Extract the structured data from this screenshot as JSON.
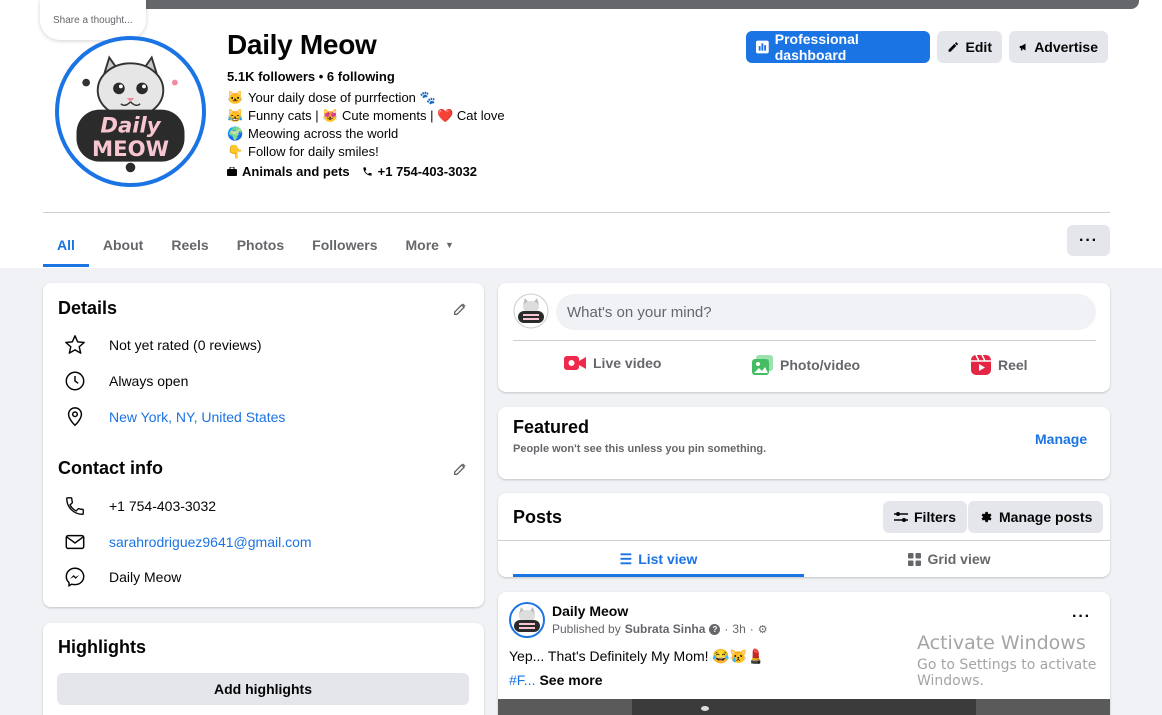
{
  "thought_bubble": "Share a thought...",
  "profile": {
    "name": "Daily Meow",
    "followers_line": "5.1K followers • 6 following",
    "bio": [
      {
        "emoji": "🐱",
        "text": "Your daily dose of purrfection 🐾"
      },
      {
        "emoji": "😹",
        "text": "Funny cats | 😻 Cute moments | ❤️ Cat love"
      },
      {
        "emoji": "🌍",
        "text": "Meowing across the world"
      },
      {
        "emoji": "👇",
        "text": "Follow for daily smiles!"
      }
    ],
    "category": "Animals and pets",
    "phone": "+1 754-403-3032",
    "logo_text_top": "Daily",
    "logo_text_bottom": "MEOW"
  },
  "actions": {
    "dashboard": "Professional dashboard",
    "edit": "Edit",
    "advertise": "Advertise"
  },
  "tabs": [
    "All",
    "About",
    "Reels",
    "Photos",
    "Followers",
    "More"
  ],
  "details": {
    "title": "Details",
    "items": [
      "Not yet rated (0 reviews)",
      "Always open",
      "New York, NY, United States"
    ]
  },
  "contact": {
    "title": "Contact info",
    "phone": "+1 754-403-3032",
    "email": "sarahrodriguez9641@gmail.com",
    "messenger": "Daily Meow"
  },
  "highlights": {
    "title": "Highlights",
    "button": "Add highlights"
  },
  "composer": {
    "placeholder": "What's on your mind?",
    "live": "Live video",
    "photo": "Photo/video",
    "reel": "Reel"
  },
  "featured": {
    "title": "Featured",
    "subtitle": "People won't see this unless you pin something.",
    "manage": "Manage"
  },
  "posts": {
    "title": "Posts",
    "filters": "Filters",
    "manage": "Manage posts",
    "list_view": "List view",
    "grid_view": "Grid view"
  },
  "post": {
    "author": "Daily Meow",
    "published_prefix": "Published by ",
    "publisher": "Subrata Sinha",
    "time": "3h",
    "text": "Yep... That's Definitely My Mom! 😂😿💄",
    "hashtag": "#F...",
    "see_more": "See more"
  },
  "watermark": {
    "line1": "Activate Windows",
    "line2": "Go to Settings to activate Windows."
  },
  "colors": {
    "accent": "#1b74e4",
    "background": "#f0f2f5",
    "live": "#f02849",
    "photo": "#45bd62",
    "reel": "#e42645"
  }
}
